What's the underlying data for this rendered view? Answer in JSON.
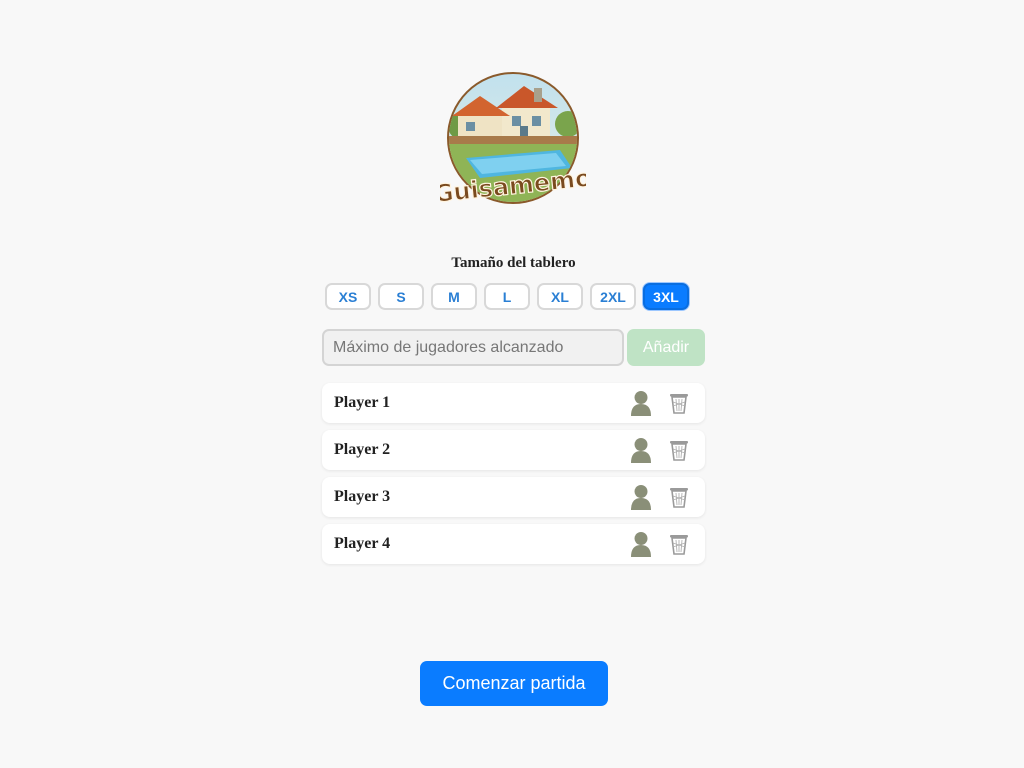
{
  "logo": {
    "text": "Guisamemo"
  },
  "board_size": {
    "label": "Tamaño del tablero",
    "options": [
      "XS",
      "S",
      "M",
      "L",
      "XL",
      "2XL",
      "3XL"
    ],
    "selected": "3XL"
  },
  "add_player": {
    "placeholder": "Máximo de jugadores alcanzado",
    "button_label": "Añadir"
  },
  "players": [
    {
      "name": "Player 1",
      "avatar_icon": "user-silhouette-icon",
      "delete_icon": "trash-icon"
    },
    {
      "name": "Player 2",
      "avatar_icon": "user-silhouette-icon",
      "delete_icon": "trash-icon"
    },
    {
      "name": "Player 3",
      "avatar_icon": "user-silhouette-icon",
      "delete_icon": "trash-icon"
    },
    {
      "name": "Player 4",
      "avatar_icon": "user-silhouette-icon",
      "delete_icon": "trash-icon"
    }
  ],
  "start_button": {
    "label": "Comenzar partida"
  },
  "colors": {
    "primary": "#0a7cff",
    "add_disabled": "#bfe3c5",
    "background": "#f8f8f8"
  }
}
